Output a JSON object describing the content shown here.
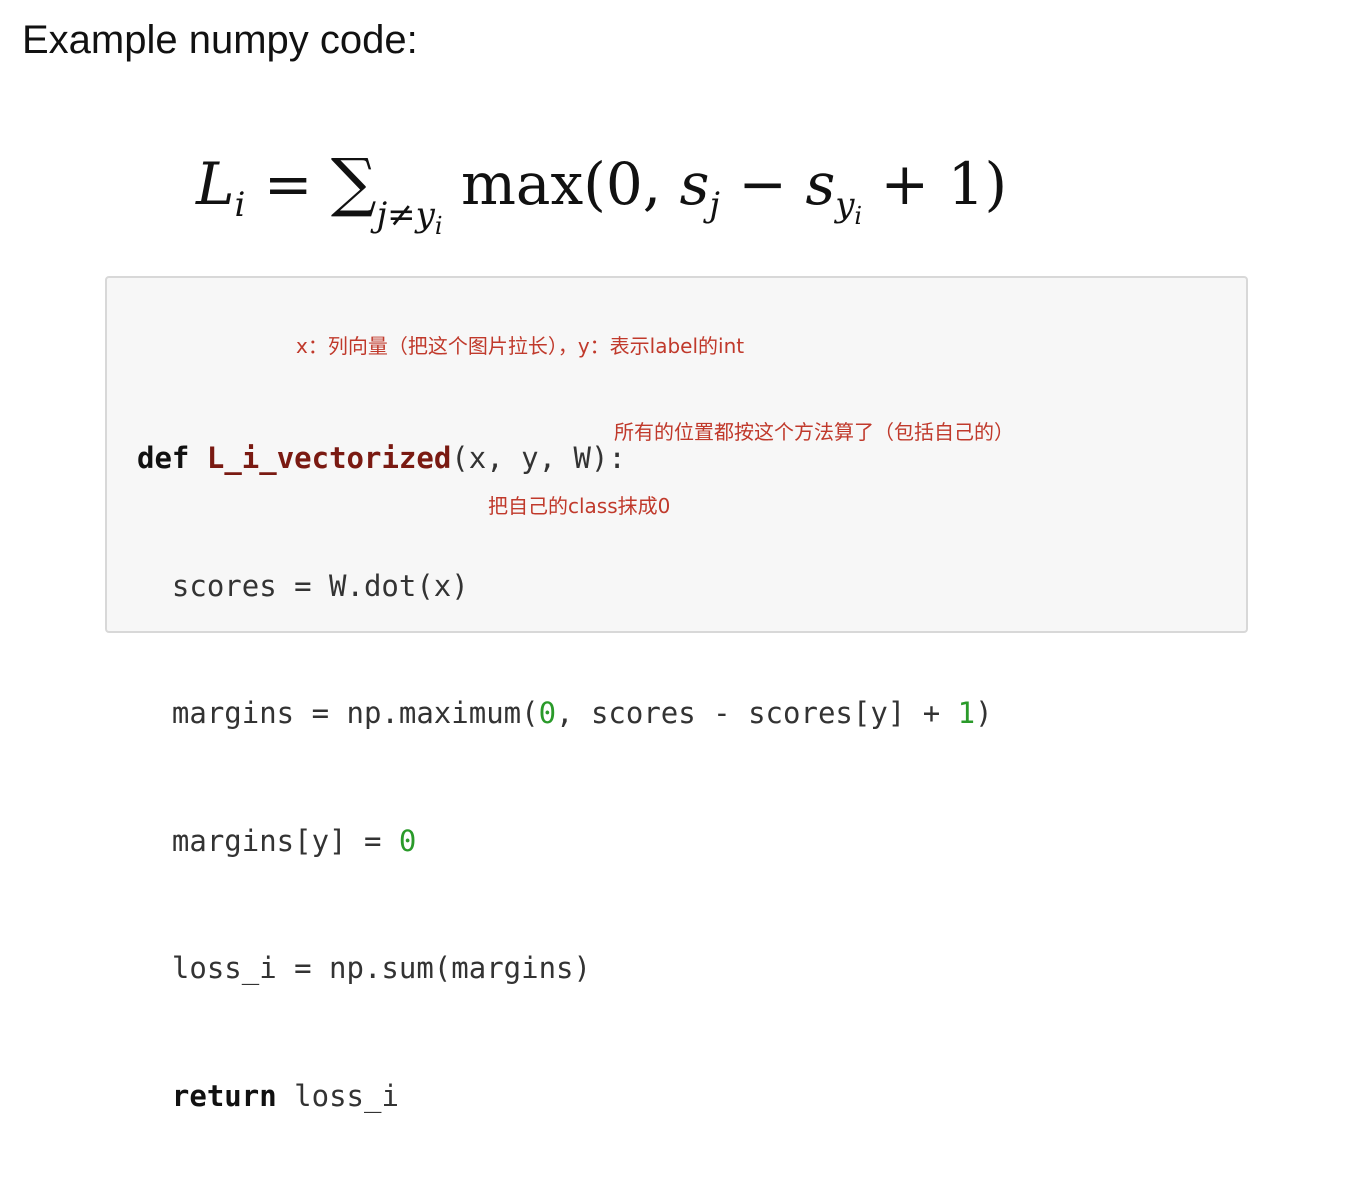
{
  "heading": "Example numpy code:",
  "formula": {
    "lhs_symbol": "L",
    "lhs_sub": "i",
    "equals": "=",
    "sum_symbol": "∑",
    "sum_sub_j": "j≠y",
    "sum_sub_i": "i",
    "max_text": "max(0, ",
    "s1": "s",
    "s1_sub": "j",
    "minus": " − ",
    "s2": "s",
    "s2_sub": "y",
    "s2_subsub": "i",
    "tail": " + 1)"
  },
  "code": {
    "line1": {
      "kw": "def",
      "fn": "L_i_vectorized",
      "rest": "(x, y, W):"
    },
    "line2": {
      "text": "  scores = W.dot(x)"
    },
    "line3": {
      "pre": "  margins = np.maximum(",
      "n0": "0",
      "mid": ", scores - scores[y] + ",
      "n1": "1",
      "post": ")"
    },
    "line4": {
      "pre": "  margins[y] = ",
      "n0": "0"
    },
    "line5": {
      "text": "  loss_i = np.sum(margins)"
    },
    "line6": {
      "kw": "return",
      "rest": " loss_i"
    }
  },
  "annotations": {
    "params_note": "x：列向量（把这个图片拉长），y：表示label的int",
    "scores_note": "所有的位置都按这个方法算了（包括自己的）",
    "margins_note": "把自己的class抹成0"
  },
  "colors": {
    "annotation": "#c0392b",
    "function_name": "#7a1a12",
    "number": "#2a9a2a",
    "code_background": "#f7f7f7"
  }
}
